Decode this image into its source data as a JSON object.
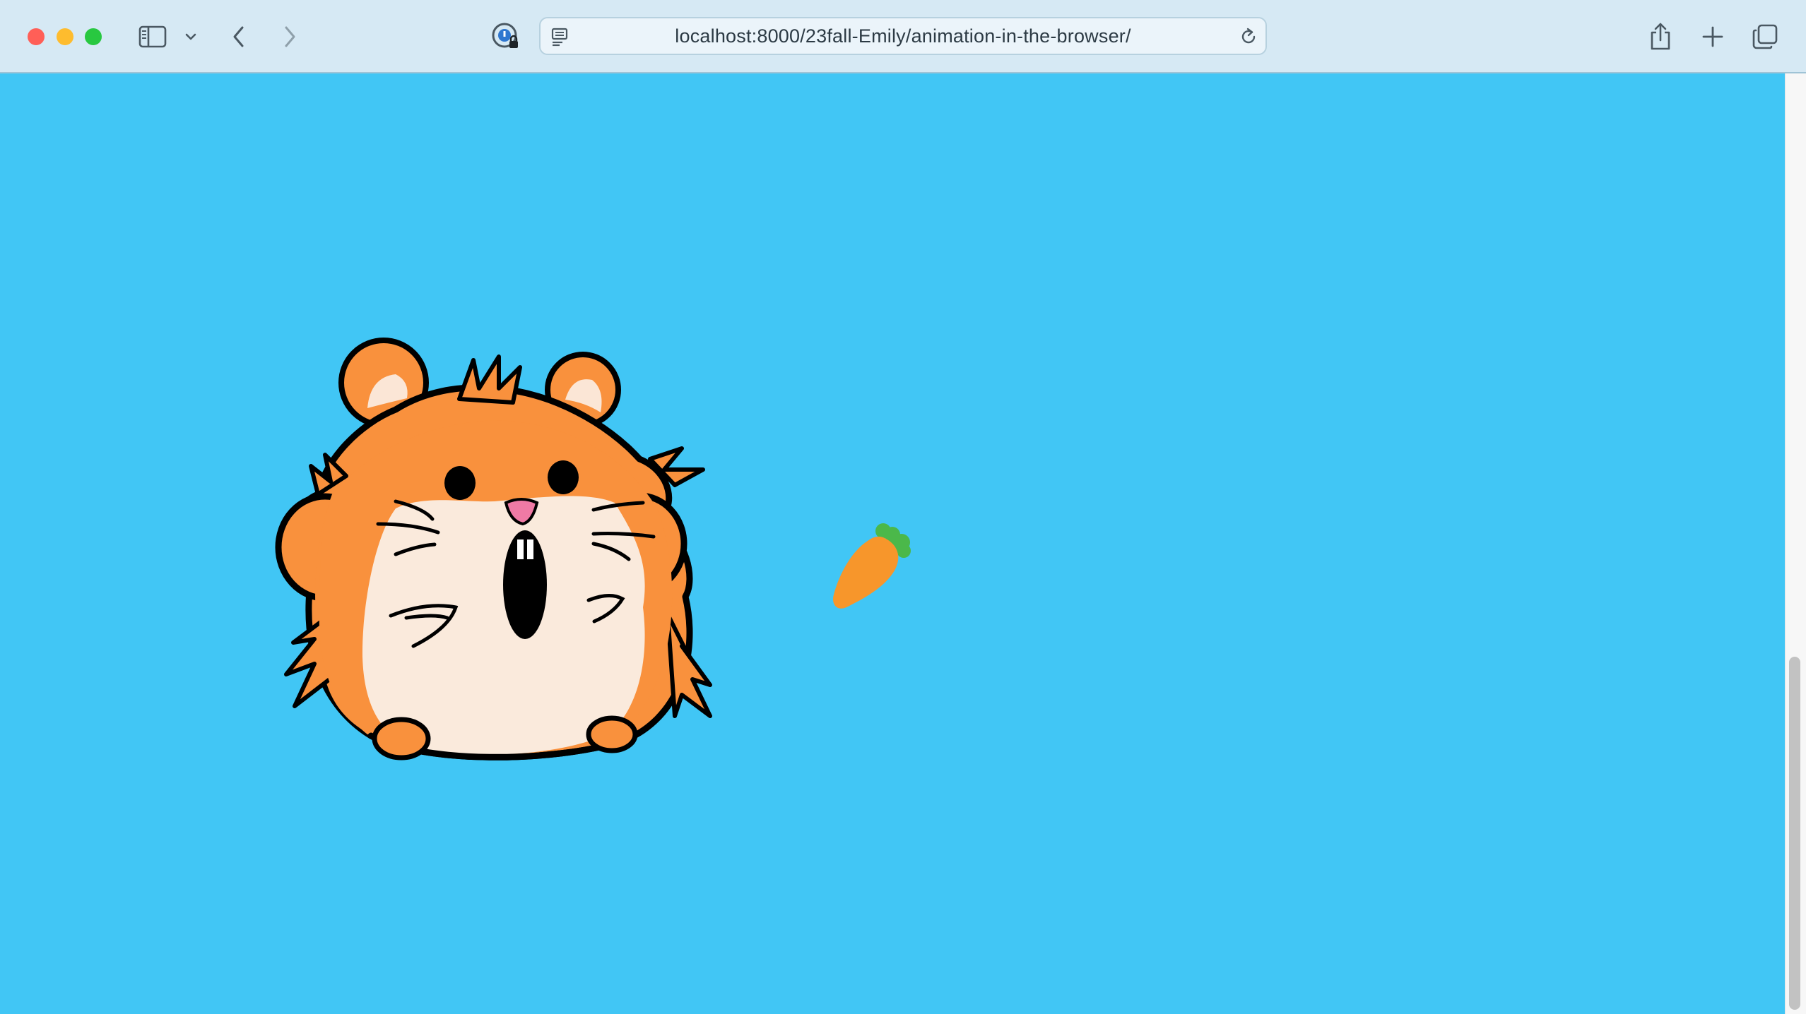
{
  "browser": {
    "url": "localhost:8000/23fall-Emily/animation-in-the-browser/",
    "icons": {
      "sidebar": "sidebar-icon",
      "dropdown": "chevron-down-icon",
      "back": "chevron-left-icon",
      "forward": "chevron-right-icon",
      "password": "password-manager-icon",
      "reader": "reader-icon",
      "reload": "reload-icon",
      "share": "share-icon",
      "new_tab": "plus-icon",
      "tabs": "tab-overview-icon"
    }
  },
  "page": {
    "background": "#41c6f5",
    "hamster_colors": {
      "fur": "#f9913d",
      "belly": "#faeadc",
      "ear_inner": "#fbe6d6",
      "nose": "#ef7aa5"
    },
    "carrot_colors": {
      "body": "#f7962b",
      "leaves": "#4bb84a"
    }
  }
}
